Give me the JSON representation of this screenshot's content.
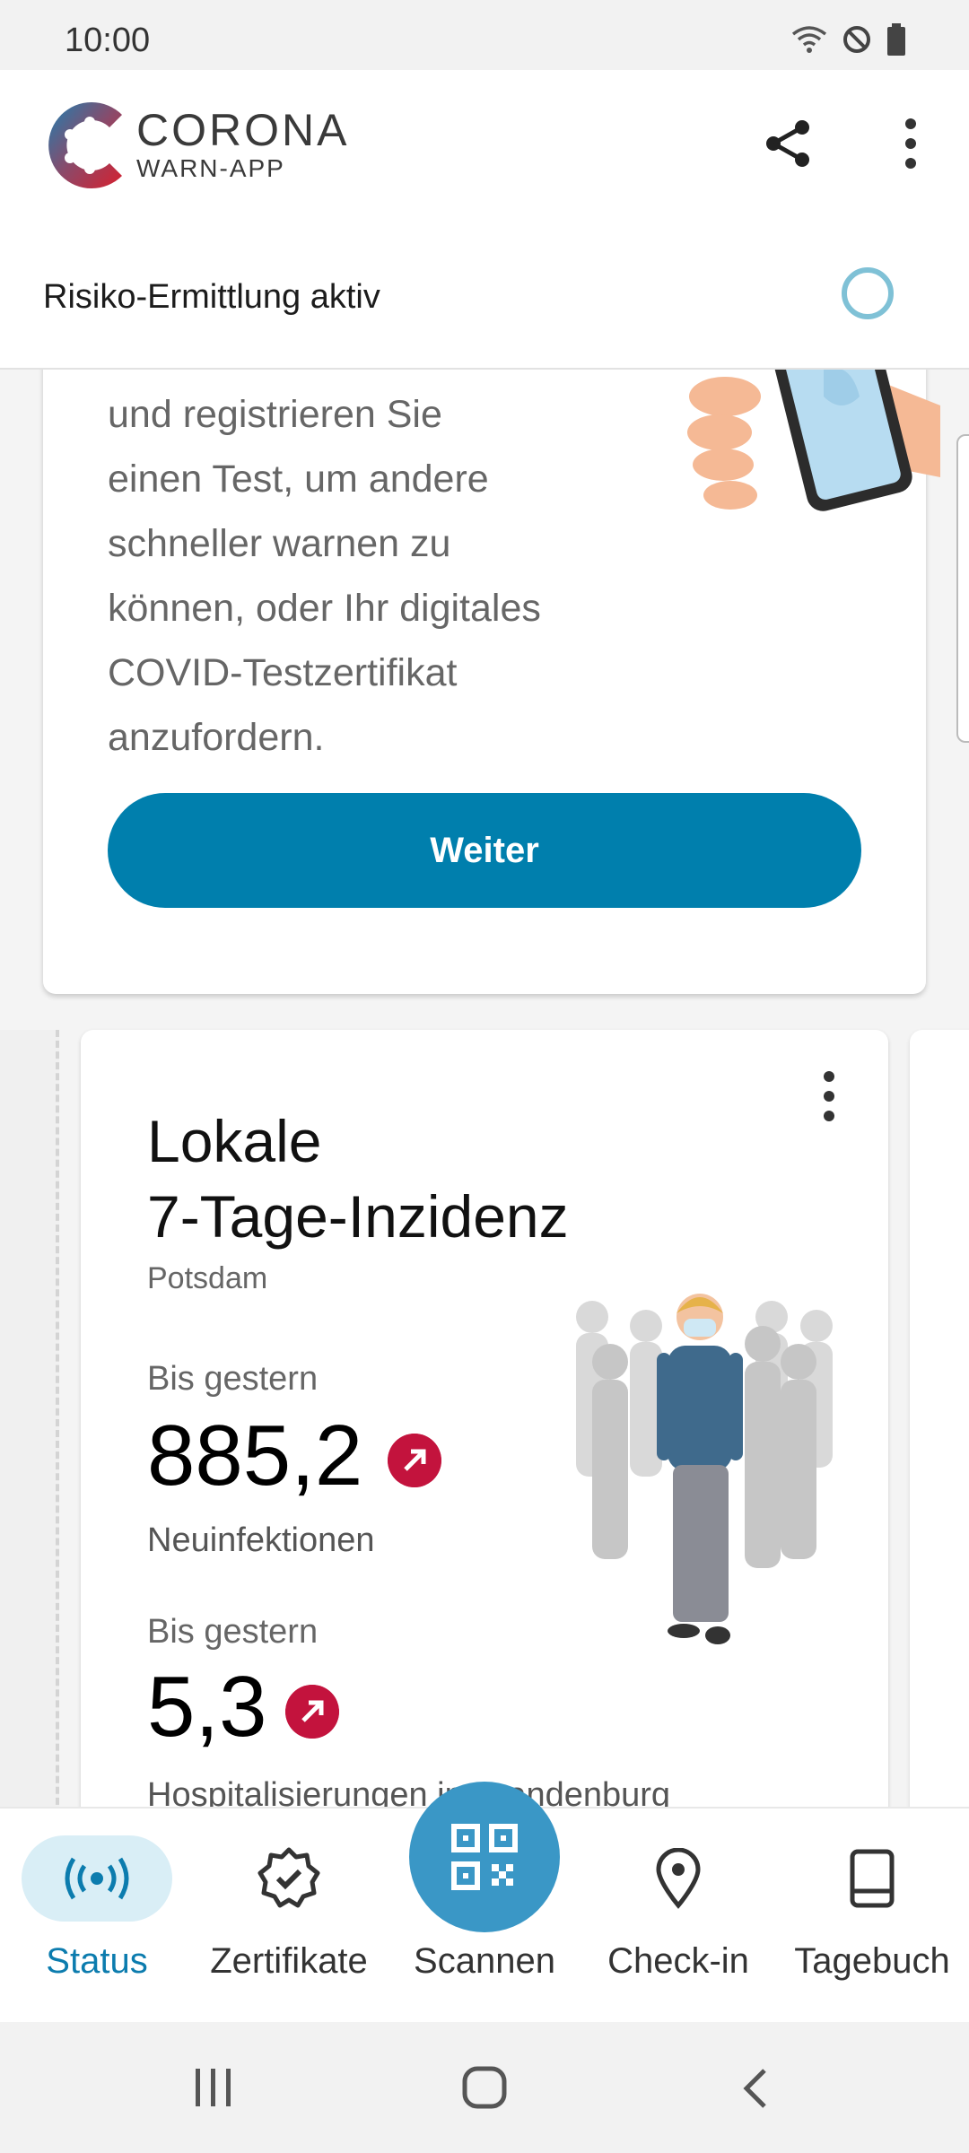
{
  "status_bar": {
    "time": "10:00"
  },
  "header": {
    "brand_line1": "CORONA",
    "brand_line2": "WARN-APP",
    "risk_status": "Risiko-Ermittlung aktiv"
  },
  "test_card": {
    "text_lines": [
      "und registrieren Sie",
      "einen Test, um andere",
      "schneller warnen zu",
      "können, oder Ihr digitales",
      "COVID-Testzertifikat",
      "anzufordern."
    ],
    "button_label": "Weiter"
  },
  "incidence_card": {
    "title_line1": "Lokale",
    "title_line2": "7-Tage-Inzidenz",
    "region": "Potsdam",
    "incidence": {
      "label": "Bis gestern",
      "value": "885,2",
      "caption": "Neuinfektionen",
      "trend": "up"
    },
    "hospitalization": {
      "label": "Bis gestern",
      "value": "5,3",
      "caption": "Hospitalisierungen in Brandenburg",
      "trend": "up"
    }
  },
  "bottom_nav": {
    "items": [
      {
        "label": "Status",
        "icon": "radar-icon",
        "active": true
      },
      {
        "label": "Zertifikate",
        "icon": "verified-badge-icon"
      },
      {
        "label": "Scannen",
        "icon": "qr-code-icon"
      },
      {
        "label": "Check-in",
        "icon": "location-pin-icon"
      },
      {
        "label": "Tagebuch",
        "icon": "book-icon"
      }
    ]
  },
  "colors": {
    "primary": "#007fad",
    "nav_active": "#0c7cae",
    "scan_button": "#3a97c6",
    "trend_up": "#c3133d",
    "risk_ring": "#7fc1d6"
  }
}
